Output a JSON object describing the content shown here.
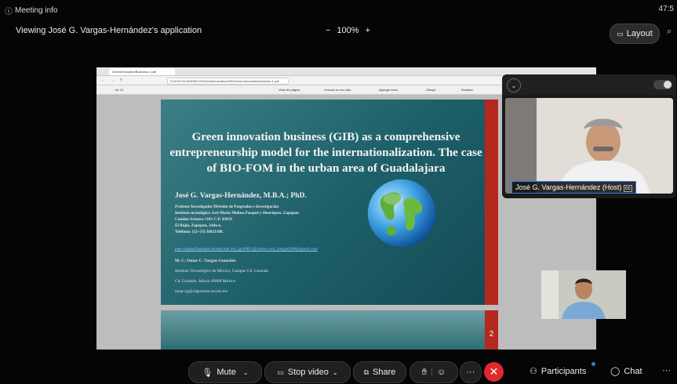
{
  "top_bar": {
    "meeting_info": "Meeting info",
    "clock": "47:5",
    "viewing": "Viewing José G. Vargas-Hernández's application",
    "zoom_minus": "−",
    "zoom_level": "100%",
    "zoom_plus": "+",
    "layout_label": "Layout"
  },
  "browser": {
    "tab_title": "GreenInnovationBusiness-1.pdf",
    "address": "D:/2022 ACADEMICOS/GreenInnovation2022/GreenInnovationBusiness-1.pdf",
    "toolbar_items": [
      "Vista de página",
      "Lectura en voz alta",
      "Agregar texto",
      "Dibujar",
      "Resaltar"
    ],
    "page_indicator": "de 15"
  },
  "slide1": {
    "title": "Green innovation business (GIB) as a comprehensive entrepreneurship model for the internationalization. The case of BIO-FOM in the urban area of Guadalajara",
    "author": "José G. Vargas-Hernández, M.B.A.; PhD.",
    "lines": [
      "Profesor Investigador División de Posgrados e Investigación",
      "Instituto tecnológico José Mario Molina Pasquel y Henríquez, Zapopan",
      "Camino Arenero 1101 C.P. 45019",
      "El Bajío, Zapopan, Jalisco.",
      "Teléfono: (52+33) 36821180."
    ],
    "emails": "jose.vargas@zapopan.tecmm.edu.mx; jgvh0811@yahoo.com; jvargas2006@gmail.com",
    "coauthor": "M. C. Omar C. Vargas-González",
    "coauthor_lines": [
      "Instituto Tecnológico de México, Campus Cd. Guzmán",
      "Cd. Guzmán, Jalisco 49000 México",
      "omar.vg@cdguzman.tecnm.mx"
    ]
  },
  "slide2": {
    "page_number": "2"
  },
  "video": {
    "host_name": "José G. Vargas-Hernández (Host)"
  },
  "controls": {
    "mute": "Mute",
    "stop_video": "Stop video",
    "share": "Share",
    "participants": "Participants",
    "chat": "Chat",
    "more": "···"
  },
  "colors": {
    "leave": "#e0282e",
    "accent": "#2e7de0",
    "slide_bg": "#1d5f68",
    "slide_strip": "#b5281e"
  }
}
